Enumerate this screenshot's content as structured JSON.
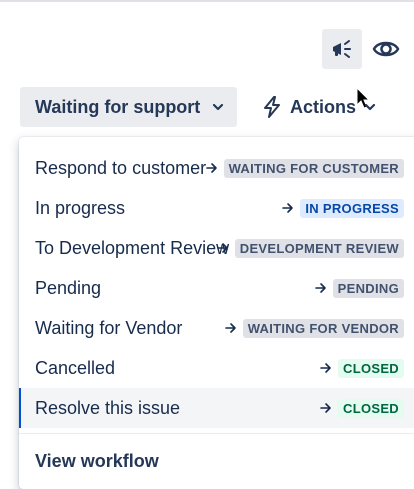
{
  "header": {
    "status_button_label": "Waiting for support",
    "actions_button_label": "Actions"
  },
  "icons": {
    "announce": "megaphone-icon",
    "watch": "eye-icon",
    "status_chevron": "chevron-down-icon",
    "actions_icon": "lightning-bolt-icon",
    "actions_chevron": "chevron-down-icon",
    "transition_arrow": "arrow-right-icon"
  },
  "colors": {
    "selected_accent": "#0052cc",
    "lozenge_grey": "#dfe1e6",
    "lozenge_blue": "#deebff",
    "lozenge_green": "#e3fcef"
  },
  "transitions": [
    {
      "label": "Respond to customer",
      "status": "WAITING FOR CUSTOMER",
      "color": "grey"
    },
    {
      "label": "In progress",
      "status": "IN PROGRESS",
      "color": "blue"
    },
    {
      "label": "To Development Review",
      "status": "DEVELOPMENT REVIEW",
      "color": "grey"
    },
    {
      "label": "Pending",
      "status": "PENDING",
      "color": "grey"
    },
    {
      "label": "Waiting for Vendor",
      "status": "WAITING FOR VENDOR",
      "color": "grey"
    },
    {
      "label": "Cancelled",
      "status": "CLOSED",
      "color": "green"
    },
    {
      "label": "Resolve this issue",
      "status": "CLOSED",
      "color": "green",
      "selected": true
    }
  ],
  "footer": {
    "view_workflow_label": "View workflow"
  }
}
